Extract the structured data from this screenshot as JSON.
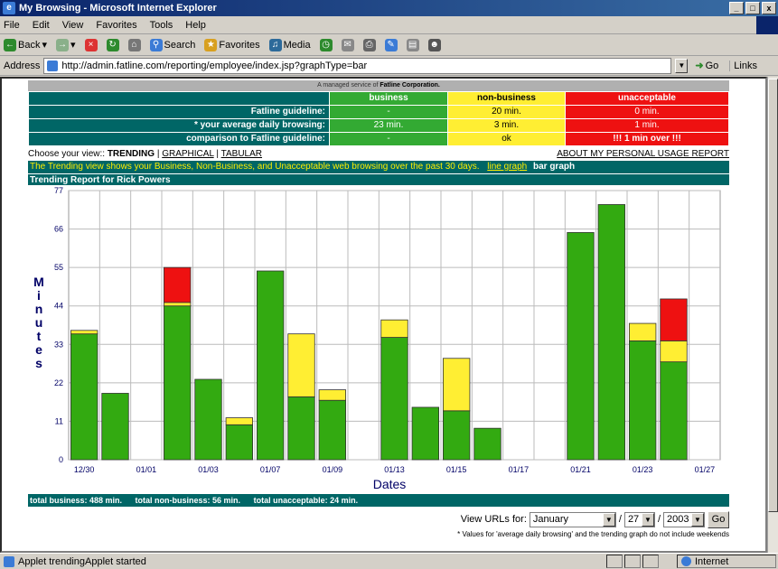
{
  "window": {
    "title": "My Browsing - Microsoft Internet Explorer",
    "controls": [
      "_",
      "□",
      "x"
    ]
  },
  "menu": [
    "File",
    "Edit",
    "View",
    "Favorites",
    "Tools",
    "Help"
  ],
  "toolbar": {
    "back": "Back",
    "search": "Search",
    "favorites": "Favorites",
    "media": "Media"
  },
  "address": {
    "label": "Address",
    "url": "http://admin.fatline.com/reporting/employee/index.jsp?graphType=bar",
    "go": "Go",
    "links": "Links"
  },
  "service": {
    "prefix": "A managed service of ",
    "company": "Fatline Corporation."
  },
  "guidelines": {
    "headers": {
      "business": "business",
      "non_business": "non-business",
      "unacceptable": "unacceptable"
    },
    "rows": [
      {
        "label": "Fatline guideline:",
        "business": "-",
        "non_business": "20 min.",
        "unacceptable": "0 min."
      },
      {
        "label": "* your average daily browsing:",
        "business": "23 min.",
        "non_business": "3 min.",
        "unacceptable": "1 min."
      },
      {
        "label": "comparison to Fatline guideline:",
        "business": "-",
        "non_business": "ok",
        "unacceptable": "!!! 1 min over !!!"
      }
    ]
  },
  "views": {
    "prefix": "Choose your view:: ",
    "trending": "TRENDING",
    "graphical": "GRAPHICAL",
    "tabular": "TABULAR",
    "sep": " | ",
    "personal_report": "ABOUT MY PERSONAL USAGE REPORT"
  },
  "info": {
    "text": "The Trending view shows your Business, Non-Business, and Unacceptable web browsing over the past 30 days.",
    "line_graph": "line graph",
    "bar_graph": "bar graph"
  },
  "report_title": "Trending Report for Rick Powers",
  "chart_data": {
    "type": "bar",
    "stacked": true,
    "xlabel": "Dates",
    "ylabel": "Minutes",
    "ylim": [
      0,
      77
    ],
    "yticks": [
      0,
      11,
      22,
      33,
      44,
      55,
      66,
      77
    ],
    "x_tick_labels": [
      "12/30",
      "01/01",
      "01/03",
      "01/07",
      "01/09",
      "01/13",
      "01/15",
      "01/17",
      "01/21",
      "01/23",
      "01/27"
    ],
    "categories": [
      "12/30",
      "12/31",
      "01/01",
      "01/02",
      "01/03",
      "01/06",
      "01/07",
      "01/08",
      "01/09",
      "01/10",
      "01/13",
      "01/14",
      "01/15",
      "01/16",
      "01/17",
      "01/20",
      "01/21",
      "01/22",
      "01/23",
      "01/24",
      "01/27"
    ],
    "series": [
      {
        "color": "#33aa11",
        "values": [
          36,
          19,
          0,
          44,
          23,
          10,
          54,
          18,
          17,
          0,
          35,
          15,
          14,
          9,
          0,
          0,
          65,
          73,
          34,
          28,
          0
        ]
      },
      {
        "color": "#ffee33",
        "values": [
          1,
          0,
          0,
          1,
          0,
          2,
          0,
          18,
          3,
          0,
          5,
          0,
          15,
          0,
          0,
          0,
          0,
          0,
          5,
          6,
          0
        ]
      },
      {
        "color": "#ee1111",
        "values": [
          0,
          0,
          0,
          10,
          0,
          0,
          0,
          0,
          0,
          0,
          0,
          0,
          0,
          0,
          0,
          0,
          0,
          0,
          0,
          12,
          0
        ]
      }
    ],
    "grid": true
  },
  "totals": {
    "business": "total business: 488 min.",
    "non_business": "total non-business: 56 min.",
    "unacceptable": "total unacceptable: 24 min."
  },
  "url_filter": {
    "label": "View URLs for:",
    "month": "January",
    "day": "27",
    "year": "2003",
    "sep": "/",
    "go": "Go"
  },
  "footnote": "* Values for 'average daily browsing' and the trending graph do not include weekends",
  "status": {
    "text": "Applet trendingApplet started",
    "zone": "Internet"
  }
}
